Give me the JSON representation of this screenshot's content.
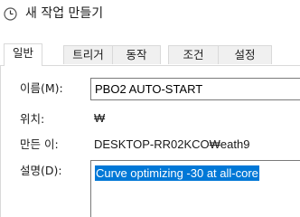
{
  "window": {
    "title": "새 작업 만들기",
    "icon": "scheduler-clock-icon"
  },
  "tabs": [
    {
      "label": "일반",
      "active": true
    },
    {
      "label": "트리거",
      "active": false
    },
    {
      "label": "동작",
      "active": false
    },
    {
      "label": "조건",
      "active": false
    },
    {
      "label": "설정",
      "active": false
    }
  ],
  "general": {
    "name_label": "이름(M):",
    "name_value": "PBO2 AUTO-START",
    "location_label": "위치:",
    "location_value": "₩",
    "author_label": "만든 이:",
    "author_value": "DESKTOP-RR02KCO₩eath9",
    "description_label": "설명(D):",
    "description_value": "Curve optimizing -30 at all-core"
  },
  "colors": {
    "selection": "#0078d7",
    "accent": "#0078d7"
  }
}
